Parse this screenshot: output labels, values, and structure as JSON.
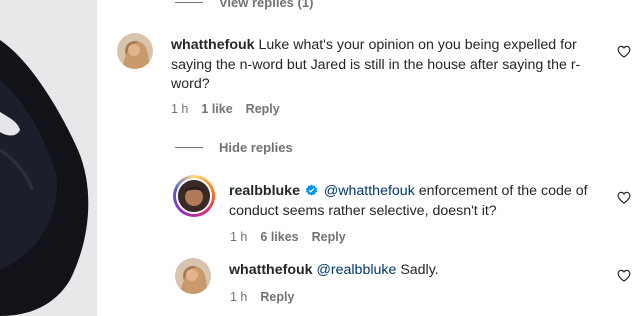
{
  "view_replies_top": "View replies (1)",
  "hide_replies": "Hide replies",
  "comments": [
    {
      "username": "whatthefouk",
      "text": "Luke what's your opinion on you being expelled for saying the n-word but Jared is still in the house after saying the r-word?",
      "time": "1 h",
      "likes": "1 like",
      "reply_label": "Reply"
    },
    {
      "username": "realbbluke",
      "verified": true,
      "mention": "@whatthefouk",
      "text": " enforcement of the code of conduct seems rather selective, doesn't it?",
      "time": "1 h",
      "likes": "6 likes",
      "reply_label": "Reply"
    },
    {
      "username": "whatthefouk",
      "mention": "@realbbluke",
      "text": " Sadly.",
      "time": "1 h",
      "reply_label": "Reply"
    }
  ],
  "colors": {
    "text": "#262626",
    "muted": "#737373",
    "mention": "#00376b",
    "verified": "#0095f6"
  }
}
